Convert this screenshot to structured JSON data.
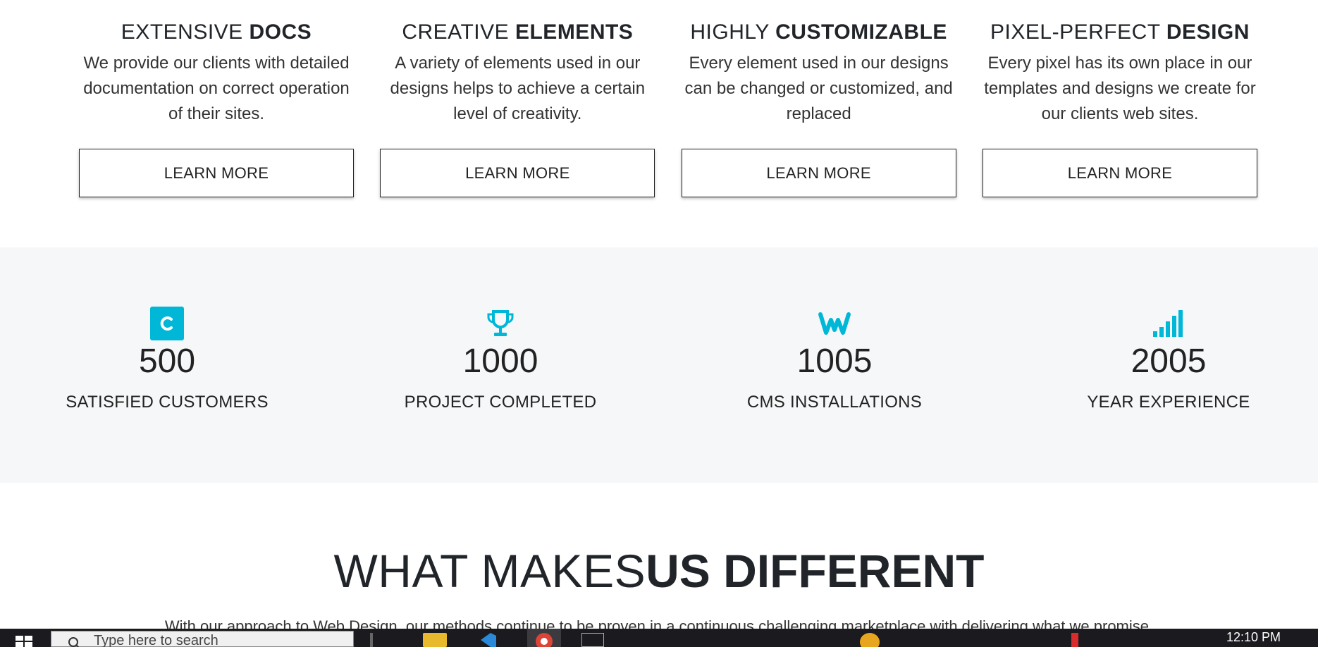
{
  "features": [
    {
      "title_light": "EXTENSIVE ",
      "title_bold": "DOCS",
      "description": "We provide our clients with detailed documentation on correct operation of their sites.",
      "button": "LEARN MORE"
    },
    {
      "title_light": "CREATIVE ",
      "title_bold": "ELEMENTS",
      "description": "A variety of elements used in our designs helps to achieve a certain level of creativity.",
      "button": "LEARN MORE"
    },
    {
      "title_light": "HIGHLY ",
      "title_bold": "CUSTOMIZABLE",
      "description": "Every element used in our designs can be changed or customized, and replaced",
      "button": "LEARN MORE"
    },
    {
      "title_light": "PIXEL-PERFECT ",
      "title_bold": "DESIGN",
      "description": "Every pixel has its own place in our templates and designs we create for our clients web sites.",
      "button": "LEARN MORE"
    }
  ],
  "stats": [
    {
      "icon": "cnet-icon",
      "number": "500",
      "label": "SATISFIED CUSTOMERS"
    },
    {
      "icon": "trophy-icon",
      "number": "1000",
      "label": "PROJECT COMPLETED"
    },
    {
      "icon": "weebly-icon",
      "number": "1005",
      "label": "CMS INSTALLATIONS"
    },
    {
      "icon": "signal-bars-icon",
      "number": "2005",
      "label": "YEAR EXPERIENCE"
    }
  ],
  "different": {
    "title_light": "WHAT MAKES",
    "title_bold": "US DIFFERENT",
    "description": "With our approach to Web Design, our methods continue to be proven in a continuous challenging marketplace with delivering what we promise."
  },
  "taskbar": {
    "search_placeholder": "Type here to search",
    "clock": "12:10 PM"
  },
  "colors": {
    "accent": "#00b7d8",
    "stats_bg": "#f6f7f9",
    "text": "#212529"
  }
}
